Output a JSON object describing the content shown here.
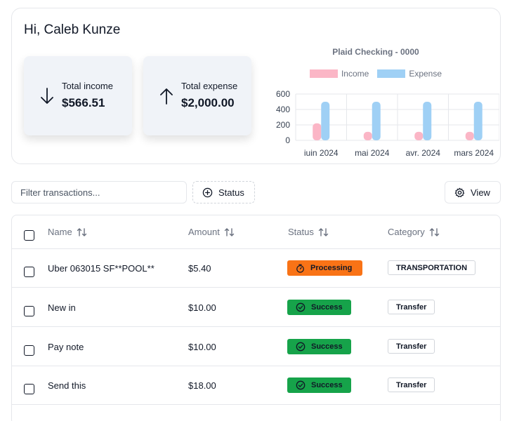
{
  "greeting": "Hi, Caleb Kunze",
  "stats": {
    "income_label": "Total income",
    "income_value": "$566.51",
    "expense_label": "Total expense",
    "expense_value": "$2,000.00"
  },
  "toolbar": {
    "filter_placeholder": "Filter transactions...",
    "status_label": "Status",
    "view_label": "View"
  },
  "table": {
    "headers": {
      "name": "Name",
      "amount": "Amount",
      "status": "Status",
      "category": "Category"
    },
    "rows": [
      {
        "name": "Uber 063015 SF**POOL**",
        "amount": "$5.40",
        "status": "Processing",
        "category": "TRANSPORTATION"
      },
      {
        "name": "New in",
        "amount": "$10.00",
        "status": "Success",
        "category": "Transfer"
      },
      {
        "name": "Pay note",
        "amount": "$10.00",
        "status": "Success",
        "category": "Transfer"
      },
      {
        "name": "Send this",
        "amount": "$18.00",
        "status": "Success",
        "category": "Transfer"
      }
    ]
  },
  "colors": {
    "income": "#fbb6c6",
    "expense": "#9fd0f5",
    "processing": "#f97316",
    "success": "#16a34a"
  },
  "chart_data": {
    "type": "bar",
    "title": "Plaid Checking - 0000",
    "categories": [
      "juin 2024",
      "mai 2024",
      "avr. 2024",
      "mars 2024"
    ],
    "series": [
      {
        "name": "Income",
        "values": [
          220,
          110,
          110,
          110
        ]
      },
      {
        "name": "Expense",
        "values": [
          500,
          500,
          500,
          500
        ]
      }
    ],
    "ylim": [
      0,
      600
    ],
    "yticks": [
      0,
      200,
      400,
      600
    ],
    "grid": true,
    "legend": "top"
  }
}
